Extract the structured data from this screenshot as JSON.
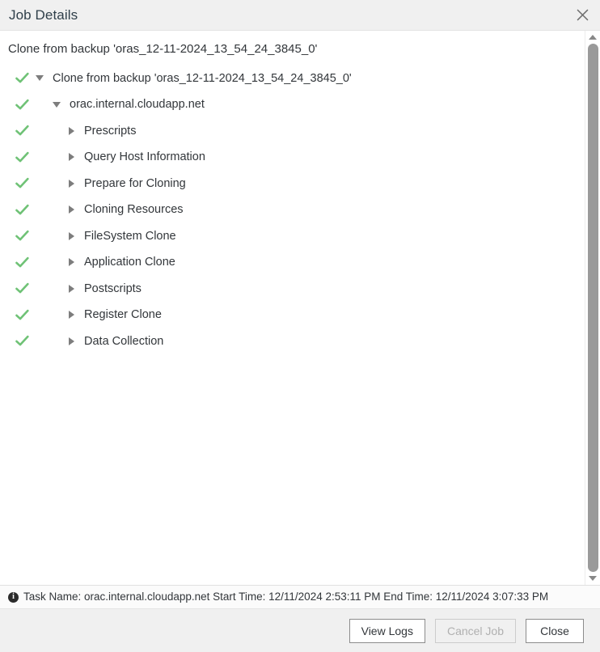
{
  "dialog": {
    "title": "Job Details",
    "close_icon": "close-icon",
    "subtitle": "Clone from backup 'oras_12-11-2024_13_54_24_3845_0'"
  },
  "colors": {
    "header_bg": "#f0f0f0",
    "title_text": "#2f3f4a",
    "success_check": "#6fc276",
    "toggle_arrow": "#7d7d7d",
    "scrollbar_thumb": "#9a9a9a",
    "body_text": "#32363a",
    "disabled_text": "#b0b0b0"
  },
  "tree": {
    "rows": [
      {
        "label": "Clone from backup 'oras_12-11-2024_13_54_24_3845_0'",
        "level": 0,
        "state": "expanded",
        "status": "success",
        "status_icon": "check-icon"
      },
      {
        "label": "orac.internal.cloudapp.net",
        "level": 1,
        "state": "expanded",
        "status": "success",
        "status_icon": "check-icon"
      },
      {
        "label": "Prescripts",
        "level": 2,
        "state": "collapsed",
        "status": "success",
        "status_icon": "check-icon"
      },
      {
        "label": "Query Host Information",
        "level": 2,
        "state": "collapsed",
        "status": "success",
        "status_icon": "check-icon"
      },
      {
        "label": "Prepare for Cloning",
        "level": 2,
        "state": "collapsed",
        "status": "success",
        "status_icon": "check-icon"
      },
      {
        "label": "Cloning Resources",
        "level": 2,
        "state": "collapsed",
        "status": "success",
        "status_icon": "check-icon"
      },
      {
        "label": "FileSystem Clone",
        "level": 2,
        "state": "collapsed",
        "status": "success",
        "status_icon": "check-icon"
      },
      {
        "label": "Application Clone",
        "level": 2,
        "state": "collapsed",
        "status": "success",
        "status_icon": "check-icon"
      },
      {
        "label": "Postscripts",
        "level": 2,
        "state": "collapsed",
        "status": "success",
        "status_icon": "check-icon"
      },
      {
        "label": "Register Clone",
        "level": 2,
        "state": "collapsed",
        "status": "success",
        "status_icon": "check-icon"
      },
      {
        "label": "Data Collection",
        "level": 2,
        "state": "collapsed",
        "status": "success",
        "status_icon": "check-icon"
      }
    ]
  },
  "scrollbar": {
    "up_icon": "chevron-up-icon",
    "down_icon": "chevron-down-icon",
    "orientation": "vertical"
  },
  "statusbar": {
    "icon": "info-icon",
    "icon_glyph": "i",
    "text": "Task Name: orac.internal.cloudapp.net Start Time: 12/11/2024 2:53:11 PM End Time: 12/11/2024 3:07:33 PM",
    "task_name": "orac.internal.cloudapp.net",
    "start_time": "12/11/2024 2:53:11 PM",
    "end_time": "12/11/2024 3:07:33 PM"
  },
  "footer": {
    "buttons": [
      {
        "label": "View Logs",
        "enabled": true
      },
      {
        "label": "Cancel Job",
        "enabled": false
      },
      {
        "label": "Close",
        "enabled": true
      }
    ]
  }
}
